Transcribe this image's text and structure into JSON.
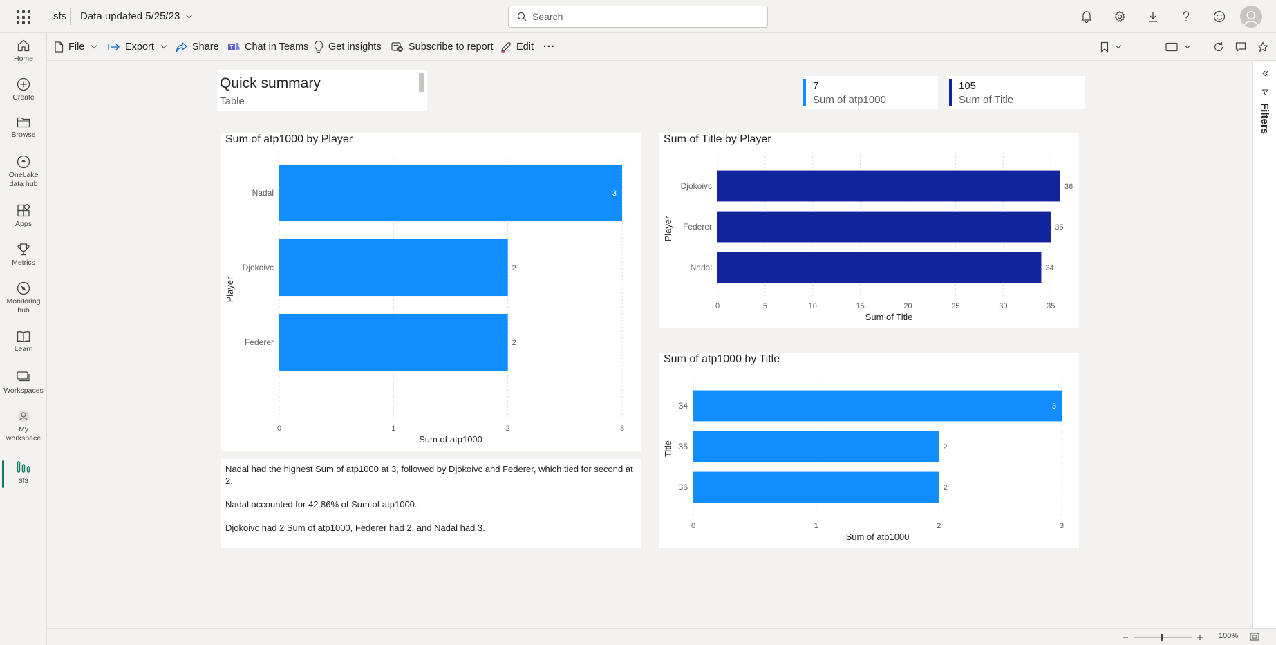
{
  "header": {
    "app_name": "sfs",
    "data_updated": "Data updated 5/25/23",
    "search_placeholder": "Search"
  },
  "nav": {
    "items": [
      {
        "label": "Home"
      },
      {
        "label": "Create"
      },
      {
        "label": "Browse"
      },
      {
        "label": "OneLake data hub"
      },
      {
        "label": "Apps"
      },
      {
        "label": "Metrics"
      },
      {
        "label": "Monitoring hub"
      },
      {
        "label": "Learn"
      },
      {
        "label": "Workspaces"
      },
      {
        "label": "My workspace"
      },
      {
        "label": "sfs"
      }
    ]
  },
  "toolbar": {
    "file": "File",
    "export": "Export",
    "share": "Share",
    "chat": "Chat in Teams",
    "insights": "Get insights",
    "subscribe": "Subscribe to report",
    "edit": "Edit",
    "more": "···"
  },
  "filters": {
    "label": "Filters"
  },
  "summary": {
    "title": "Quick summary",
    "subtitle": "Table"
  },
  "kpis": [
    {
      "value": "7",
      "label": "Sum of atp1000",
      "color": "#118DFF"
    },
    {
      "value": "105",
      "label": "Sum of Title",
      "color": "#12239E"
    }
  ],
  "narrative": [
    "Nadal had the highest Sum of atp1000 at 3, followed by Djokoivc and Federer, which tied for second at 2.",
    "Nadal accounted for 42.86% of Sum of atp1000.",
    "Djokoivc had 2 Sum of atp1000, Federer had 2, and Nadal had 3."
  ],
  "status": {
    "zoom": "100%"
  },
  "chart_data": [
    {
      "type": "bar",
      "orientation": "horizontal",
      "title": "Sum of atp1000 by Player",
      "xlabel": "Sum of atp1000",
      "ylabel": "Player",
      "categories": [
        "Nadal",
        "Djokoivc",
        "Federer"
      ],
      "values": [
        3,
        2,
        2
      ],
      "xlim": [
        0,
        3
      ],
      "ticks": [
        0,
        1,
        2,
        3
      ],
      "color": "#118DFF"
    },
    {
      "type": "bar",
      "orientation": "horizontal",
      "title": "Sum of Title by Player",
      "xlabel": "Sum of Title",
      "ylabel": "Player",
      "categories": [
        "Djokoivc",
        "Federer",
        "Nadal"
      ],
      "values": [
        36,
        35,
        34
      ],
      "xlim": [
        0,
        36
      ],
      "ticks": [
        0,
        5,
        10,
        15,
        20,
        25,
        30,
        35
      ],
      "color": "#12239E"
    },
    {
      "type": "bar",
      "orientation": "horizontal",
      "title": "Sum of atp1000 by Title",
      "xlabel": "Sum of atp1000",
      "ylabel": "Title",
      "categories": [
        "34",
        "35",
        "36"
      ],
      "values": [
        3,
        2,
        2
      ],
      "xlim": [
        0,
        3
      ],
      "ticks": [
        0,
        1,
        2,
        3
      ],
      "color": "#118DFF"
    }
  ]
}
